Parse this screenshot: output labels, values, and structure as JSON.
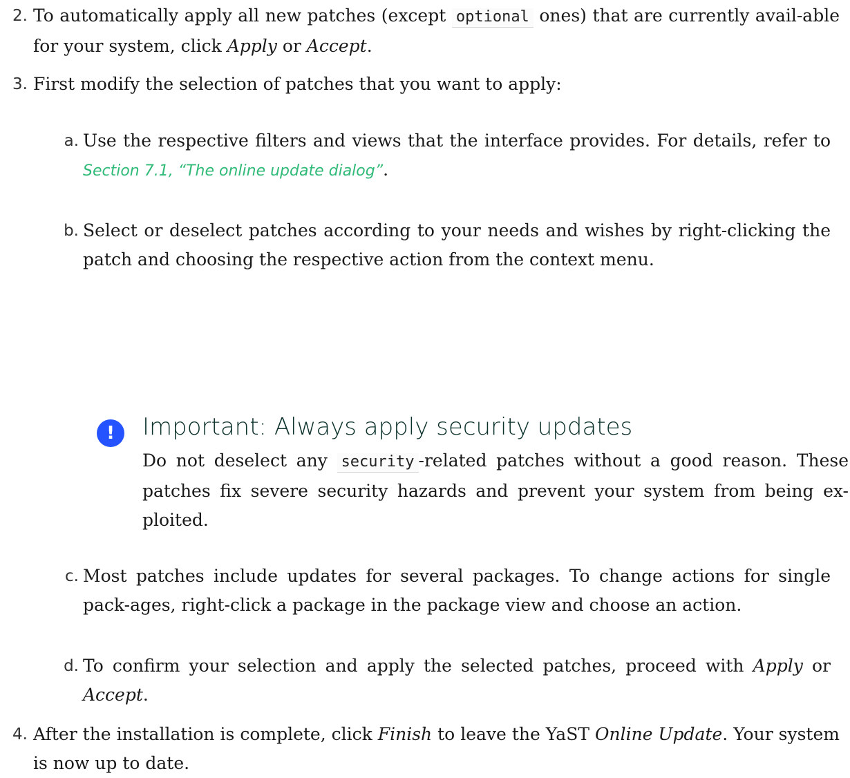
{
  "steps": [
    {
      "num": "2.",
      "t1": "To automatically apply all new patches (except ",
      "code": "optional",
      "t2": " ones) that are currently avail-able for your system, click ",
      "em1": "Apply",
      "t3": " or ",
      "em2": "Accept",
      "t4": "."
    },
    {
      "num": "3.",
      "text": "First modify the selection of patches that you want to apply:"
    },
    {
      "num": "4.",
      "t1": "After the installation is complete, click ",
      "em1": "Finish",
      "t2": " to leave the YaST ",
      "em2": "Online Update",
      "t3": ". Your system is now up to date."
    }
  ],
  "substeps": [
    {
      "num": "a.",
      "t1": "Use the respective filters and views that the interface provides. For details, refer to ",
      "link": "Section 7.1, “The online update dialog”",
      "t2": "."
    },
    {
      "num": "b.",
      "text": "Select or deselect patches according to your needs and wishes by right-clicking the patch and choosing the respective action from the context menu."
    },
    {
      "num": "c.",
      "text": "Most patches include updates for several packages. To change actions for single pack-ages, right-click a package in the package view and choose an action."
    },
    {
      "num": "d.",
      "t1": "To confirm your selection and apply the selected patches, proceed with ",
      "em1": "Apply",
      "t2": " or ",
      "em2": "Accept",
      "t3": "."
    }
  ],
  "callout": {
    "icon": "!",
    "icon_name": "important-exclamation-icon",
    "title": "Important: Always apply security updates",
    "body_t1": "Do not deselect any ",
    "body_code": "security",
    "body_t2": "-related patches without a good reason. These patches fix severe security hazards and prevent your system from being ex-ploited."
  },
  "colors": {
    "link": "#30ba78",
    "icon_bg": "#2453ff",
    "title": "#0c322c"
  }
}
